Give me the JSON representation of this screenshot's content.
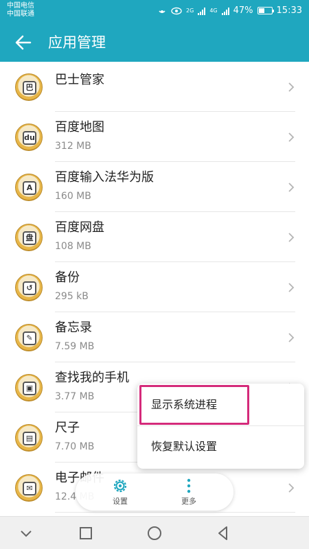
{
  "status_bar": {
    "carrier1": "中国电信",
    "carrier2": "中国联通",
    "net1": "2G",
    "net2": "4G",
    "battery_percent": "47%",
    "battery_level": 0.47,
    "time": "15:33"
  },
  "app_bar": {
    "title": "应用管理",
    "back_icon": "arrow-left-icon"
  },
  "apps": [
    {
      "name": "巴士管家",
      "size": "",
      "glyph": "巴"
    },
    {
      "name": "百度地图",
      "size": "312 MB",
      "glyph": "du"
    },
    {
      "name": "百度输入法华为版",
      "size": "160 MB",
      "glyph": "A"
    },
    {
      "name": "百度网盘",
      "size": "108 MB",
      "glyph": "盘"
    },
    {
      "name": "备份",
      "size": "295 kB",
      "glyph": "↺"
    },
    {
      "name": "备忘录",
      "size": "7.59 MB",
      "glyph": "✎"
    },
    {
      "name": "查找我的手机",
      "size": "3.77 MB",
      "glyph": "▣"
    },
    {
      "name": "尺子",
      "size": "7.70 MB",
      "glyph": "▤"
    },
    {
      "name": "电子邮件",
      "size": "12.4 MB",
      "glyph": "✉"
    }
  ],
  "popup_menu": {
    "items": [
      "显示系统进程",
      "恢复默认设置"
    ]
  },
  "bottom_actions": {
    "settings_label": "设置",
    "more_label": "更多"
  },
  "colors": {
    "accent": "#1fa7bf",
    "highlight": "#d42a7a"
  }
}
